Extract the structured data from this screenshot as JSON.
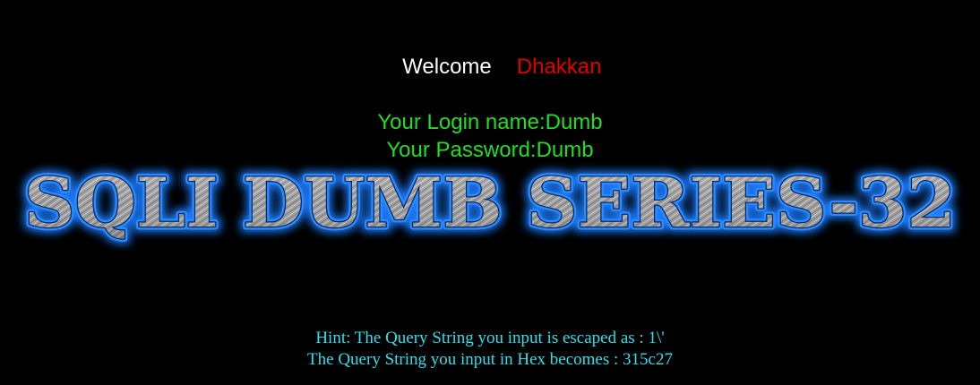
{
  "welcome": {
    "label": "Welcome",
    "name": "Dhakkan"
  },
  "login": {
    "name_line": "Your Login name:Dumb",
    "password_line": "Your Password:Dumb"
  },
  "banner": {
    "text": "SQLI DUMB SERIES-32",
    "fill_color": "#9a9a9a",
    "glow_color": "#1e7bff"
  },
  "hint": {
    "escaped_line": "Hint: The Query String you input is escaped as : 1\\'",
    "hex_line": "The Query String you input in Hex becomes : 315c27"
  },
  "colors": {
    "background": "#000000",
    "welcome": "#ffffff",
    "name": "#e00000",
    "login": "#22dd22",
    "hint": "#2fe0ea"
  }
}
